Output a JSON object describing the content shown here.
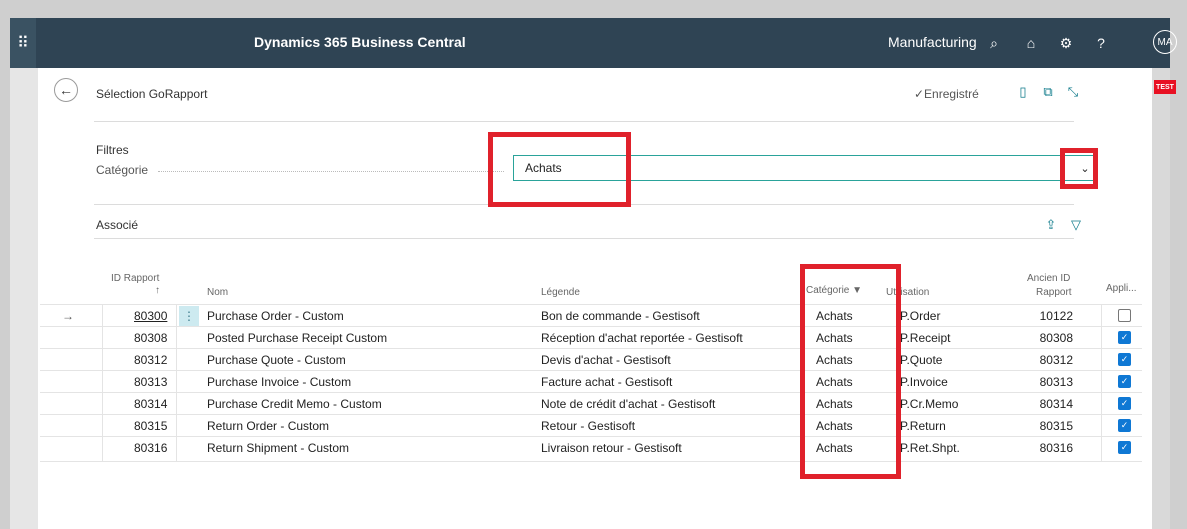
{
  "app": {
    "title": "Dynamics 365 Business Central",
    "company": "Manufacturing",
    "avatar": "MA",
    "test_badge": "TEST",
    "waffle_icon": "⠿"
  },
  "topbar_icons": [
    {
      "name": "search-icon",
      "glyph": "⌕"
    },
    {
      "name": "bell-icon",
      "glyph": "⌂"
    },
    {
      "name": "gear-icon",
      "glyph": "⚙"
    },
    {
      "name": "help-icon",
      "glyph": "?"
    }
  ],
  "page": {
    "title": "Sélection GoRapport",
    "saved": "✓Enregistré"
  },
  "filters": {
    "title": "Filtres",
    "category_label": "Catégorie",
    "category_value": "Achats"
  },
  "associe_label": "Associé",
  "table": {
    "headers": {
      "id": "ID Rapport",
      "sort": "↑",
      "name": "Nom",
      "legend": "Légende",
      "category": "Catégorie",
      "usage": "Utilisation",
      "old_id_1": "Ancien ID",
      "old_id_2": "Rapport",
      "apply": "Appli..."
    },
    "rows": [
      {
        "id": "80300",
        "name": "Purchase Order - Custom",
        "legend": "Bon de commande - Gestisoft",
        "category": "Achats",
        "usage": "P.Order",
        "old_id": "10122",
        "apply": false
      },
      {
        "id": "80308",
        "name": "Posted Purchase Receipt Custom",
        "legend": "Réception d'achat reportée - Gestisoft",
        "category": "Achats",
        "usage": "P.Receipt",
        "old_id": "80308",
        "apply": true
      },
      {
        "id": "80312",
        "name": "Purchase Quote - Custom",
        "legend": "Devis d'achat - Gestisoft",
        "category": "Achats",
        "usage": "P.Quote",
        "old_id": "80312",
        "apply": true
      },
      {
        "id": "80313",
        "name": "Purchase Invoice - Custom",
        "legend": "Facture achat - Gestisoft",
        "category": "Achats",
        "usage": "P.Invoice",
        "old_id": "80313",
        "apply": true
      },
      {
        "id": "80314",
        "name": "Purchase Credit Memo - Custom",
        "legend": "Note de crédit d'achat - Gestisoft",
        "category": "Achats",
        "usage": "P.Cr.Memo",
        "old_id": "80314",
        "apply": true
      },
      {
        "id": "80315",
        "name": "Return Order - Custom",
        "legend": "Retour - Gestisoft",
        "category": "Achats",
        "usage": "P.Return",
        "old_id": "80315",
        "apply": true
      },
      {
        "id": "80316",
        "name": "Return Shipment - Custom",
        "legend": "Livraison retour - Gestisoft",
        "category": "Achats",
        "usage": "P.Ret.Shpt.",
        "old_id": "80316",
        "apply": true
      }
    ]
  },
  "colors": {
    "topbar": "#2f4454",
    "accent": "#0e7a8a",
    "highlight": "#e0212b",
    "checkbox": "#0f78d4"
  }
}
